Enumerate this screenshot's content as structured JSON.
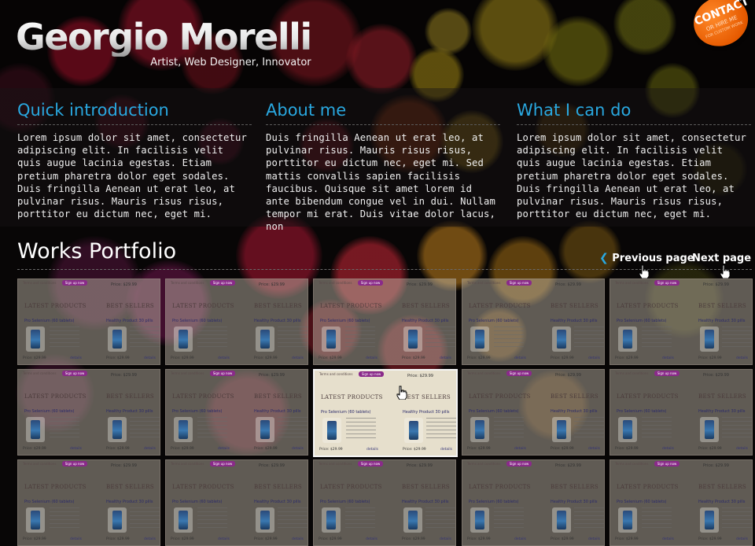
{
  "header": {
    "name": "Georgio Morelli",
    "tagline": "Artist, Web Designer, Innovator",
    "contact_badge": {
      "title": "CONTACT",
      "line1": "OR HIRE ME",
      "line2": "FOR CUSTOM WORK"
    }
  },
  "intro_columns": [
    {
      "title": "Quick introduction",
      "text": "Lorem ipsum dolor sit amet, consectetur adipiscing elit. In facilisis velit quis augue lacinia egestas. Etiam pretium pharetra dolor eget sodales. Duis fringilla Aenean ut erat leo, at pulvinar risus. Mauris risus risus, porttitor eu dictum nec, eget mi."
    },
    {
      "title": "About me",
      "text": "Duis fringilla Aenean ut erat leo, at pulvinar risus. Mauris risus risus, porttitor eu dictum nec, eget mi. Sed mattis convallis sapien facilisis faucibus. Quisque sit amet lorem id ante bibendum congue vel in dui. Nullam tempor mi erat. Duis vitae dolor lacus, non"
    },
    {
      "title": "What I can do",
      "text": "Lorem ipsum dolor sit amet, consectetur adipiscing elit. In facilisis velit quis augue lacinia egestas. Etiam pretium pharetra dolor eget sodales. Duis fringilla Aenean ut erat leo, at pulvinar risus. Mauris risus risus, porttitor eu dictum nec, eget mi."
    }
  ],
  "portfolio": {
    "title": "Works Portfolio",
    "prev_label": "Previous page",
    "next_label": "Next page",
    "thumb": {
      "top_text": "Terms and conditions",
      "pill": "Sign up now",
      "price": "Price: $29.99",
      "latest": "LATEST PRODUCTS",
      "best": "BEST SELLERS",
      "product_left": "Pro Selenium (60 tablets)",
      "product_right": "Healthy Product 30 pills",
      "details": "details"
    }
  },
  "colors": {
    "accent": "#29a8e0",
    "contact_orange": "#e65a00"
  }
}
